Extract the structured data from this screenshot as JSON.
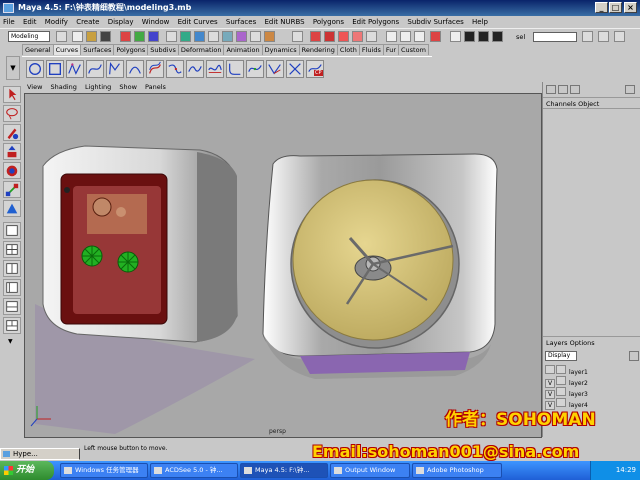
{
  "window": {
    "title": "Maya 4.5: F:\\钟表精细教程\\modeling3.mb"
  },
  "menubar": [
    "File",
    "Edit",
    "Modify",
    "Create",
    "Display",
    "Window",
    "Edit Curves",
    "Surfaces",
    "Edit NURBS",
    "Polygons",
    "Edit Polygons",
    "Subdiv Surfaces",
    "Help"
  ],
  "statusline": {
    "mode": "Modeling",
    "sel_label": "sel"
  },
  "shelf_tabs": [
    "General",
    "Curves",
    "Surfaces",
    "Polygons",
    "Subdivs",
    "Deformation",
    "Animation",
    "Dynamics",
    "Rendering",
    "Cloth",
    "Fluids",
    "Fur",
    "Custom"
  ],
  "shelf_active": "Curves",
  "shelf_icon_cp_label": "CP",
  "panel_menu": [
    "View",
    "Shading",
    "Lighting",
    "Show",
    "Panels"
  ],
  "viewport": {
    "camera_label": "persp"
  },
  "right_panel": {
    "channels_header": "Channels  Object",
    "layers_header": "Layers  Options",
    "display_select": "Display",
    "layers": [
      {
        "name": "layer1",
        "visible": ""
      },
      {
        "name": "layer2",
        "visible": "V"
      },
      {
        "name": "layer3",
        "visible": "V"
      },
      {
        "name": "layer4",
        "visible": "V"
      }
    ]
  },
  "helpline": "Left mouse button to move.",
  "mini_window": "Hype...",
  "taskbar": {
    "start": "开始",
    "items": [
      "Windows 任务管理器",
      "ACDSee 5.0 - 钟...",
      "Maya 4.5: F:\\钟...",
      "Output Window",
      "Adobe Photoshop"
    ],
    "clock": "14:29"
  },
  "watermark": {
    "author": "作者：SOHOMAN",
    "email": "Email:sohoman001@sina.com"
  },
  "colors": {
    "title_bg": "#0a246a",
    "viewport_bg": "#a8a8a8",
    "clock_face": "#d6c278",
    "watermark_fill": "#ffd200",
    "watermark_stroke": "#b00000"
  }
}
